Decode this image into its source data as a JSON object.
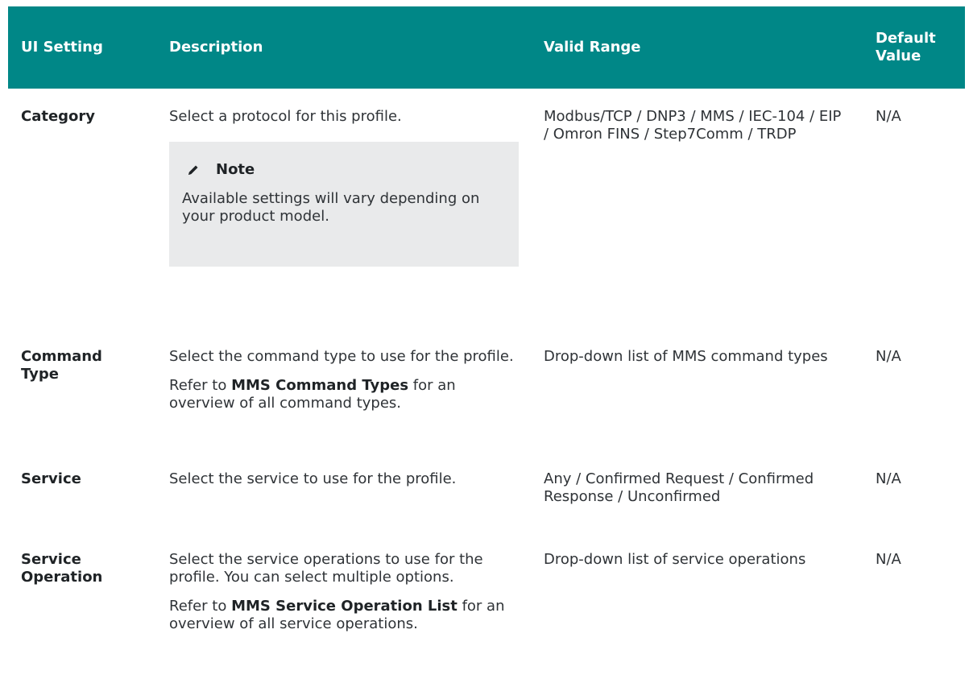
{
  "header": {
    "col1": "UI Setting",
    "col2": "Description",
    "col3": "Valid Range",
    "col4": "Default Value"
  },
  "rows": [
    {
      "setting": "Category",
      "description": [
        "Select a protocol for this profile."
      ],
      "range": "Modbus/TCP / DNP3 / MMS / IEC-104 / EIP / Omron FINS / Step7Comm / TRDP",
      "default": "N/A",
      "note": {
        "title": "Note",
        "text": "Available settings will vary depending on your product model.",
        "icon": "pencil-icon"
      }
    },
    {
      "setting": "Command Type",
      "description": [
        "Select the command type to use for the profile."
      ],
      "refer_prefix": "Refer to ",
      "refer_link": "MMS Command Types",
      "refer_suffix": " for an overview of all command types.",
      "range": "Drop-down list of MMS command types",
      "default": "N/A"
    },
    {
      "setting": "Service",
      "description": [
        "Select the service to use for the profile."
      ],
      "range": "Any / Confirmed Request / Confirmed Response / Unconfirmed",
      "default": "N/A"
    },
    {
      "setting": "Service Operation",
      "description": [
        "Select the service operations to use for the profile. You can select multiple options."
      ],
      "refer_prefix": "Refer to ",
      "refer_link": "MMS Service Operation List",
      "refer_suffix": " for an overview of all service operations.",
      "range": "Drop-down list of service operations",
      "default": "N/A"
    }
  ],
  "colors": {
    "header_bg": "#008787",
    "note_bg": "#e9eaeb"
  }
}
